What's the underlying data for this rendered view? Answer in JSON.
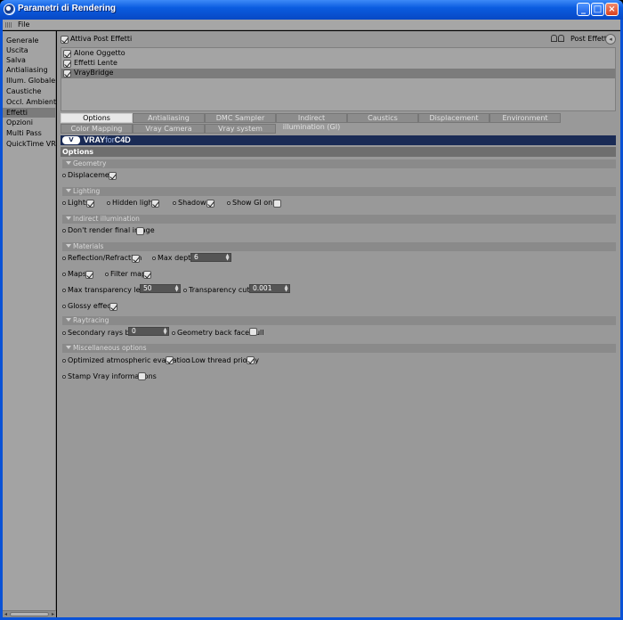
{
  "window": {
    "title": "Parametri di Rendering"
  },
  "menu": {
    "file": "File"
  },
  "sidebar": {
    "items": [
      {
        "label": "Generale"
      },
      {
        "label": "Uscita"
      },
      {
        "label": "Salva"
      },
      {
        "label": "Antialiasing"
      },
      {
        "label": "Illum. Globale"
      },
      {
        "label": "Caustiche"
      },
      {
        "label": "Occl. Ambientale"
      },
      {
        "label": "Effetti",
        "active": true
      },
      {
        "label": "Opzioni"
      },
      {
        "label": "Multi Pass"
      },
      {
        "label": "QuickTime VR"
      }
    ]
  },
  "post": {
    "activate_label": "Attiva Post Effetti",
    "activate_checked": true,
    "header_right": "Post Effetti",
    "items": [
      {
        "label": "Alone Oggetto",
        "checked": true
      },
      {
        "label": "Effetti Lente",
        "checked": true
      },
      {
        "label": "VrayBridge",
        "checked": true,
        "selected": true
      }
    ]
  },
  "tabs": {
    "row1": [
      "Options",
      "Antialiasing",
      "DMC Sampler",
      "Indirect illumination (GI)",
      "Caustics",
      "Displacement",
      "Environment"
    ],
    "row2": [
      "Color Mapping",
      "Vray Camera",
      "Vray system"
    ],
    "active": "Options"
  },
  "brand": {
    "vray": "VRAY",
    "for": "for",
    "c4d": "C4D",
    "icon": "V"
  },
  "options_title": "Options",
  "sections": {
    "geometry": "Geometry",
    "lighting": "Lighting",
    "indirect": "Indirect illumination",
    "materials": "Materials",
    "raytracing": "Raytracing",
    "misc": "Miscellaneous options"
  },
  "fields": {
    "displacement": "Displacement",
    "lights": "Lights",
    "hidden_lights": "Hidden lights",
    "shadows": "Shadows",
    "show_gi_only": "Show GI only",
    "dont_render_final": "Don't render final image",
    "reflection_refraction": "Reflection/Refraction",
    "max_depth": "Max depth",
    "max_depth_value": "6",
    "maps": "Maps",
    "filter_maps": "Filter maps",
    "max_transparency": "Max transparency levels",
    "max_transparency_value": "50",
    "transparency_cutoff": "Transparency cutoff",
    "transparency_cutoff_value": "0.001",
    "glossy_effects": "Glossy effects",
    "secondary_rays_bias": "Secondary rays bias",
    "secondary_rays_bias_value": "0",
    "geometry_backface": "Geometry back face cull",
    "optimized_atmo": "Optimized atmospheric evaluation",
    "low_thread": "Low thread priority",
    "stamp_vray": "Stamp Vray informations"
  }
}
